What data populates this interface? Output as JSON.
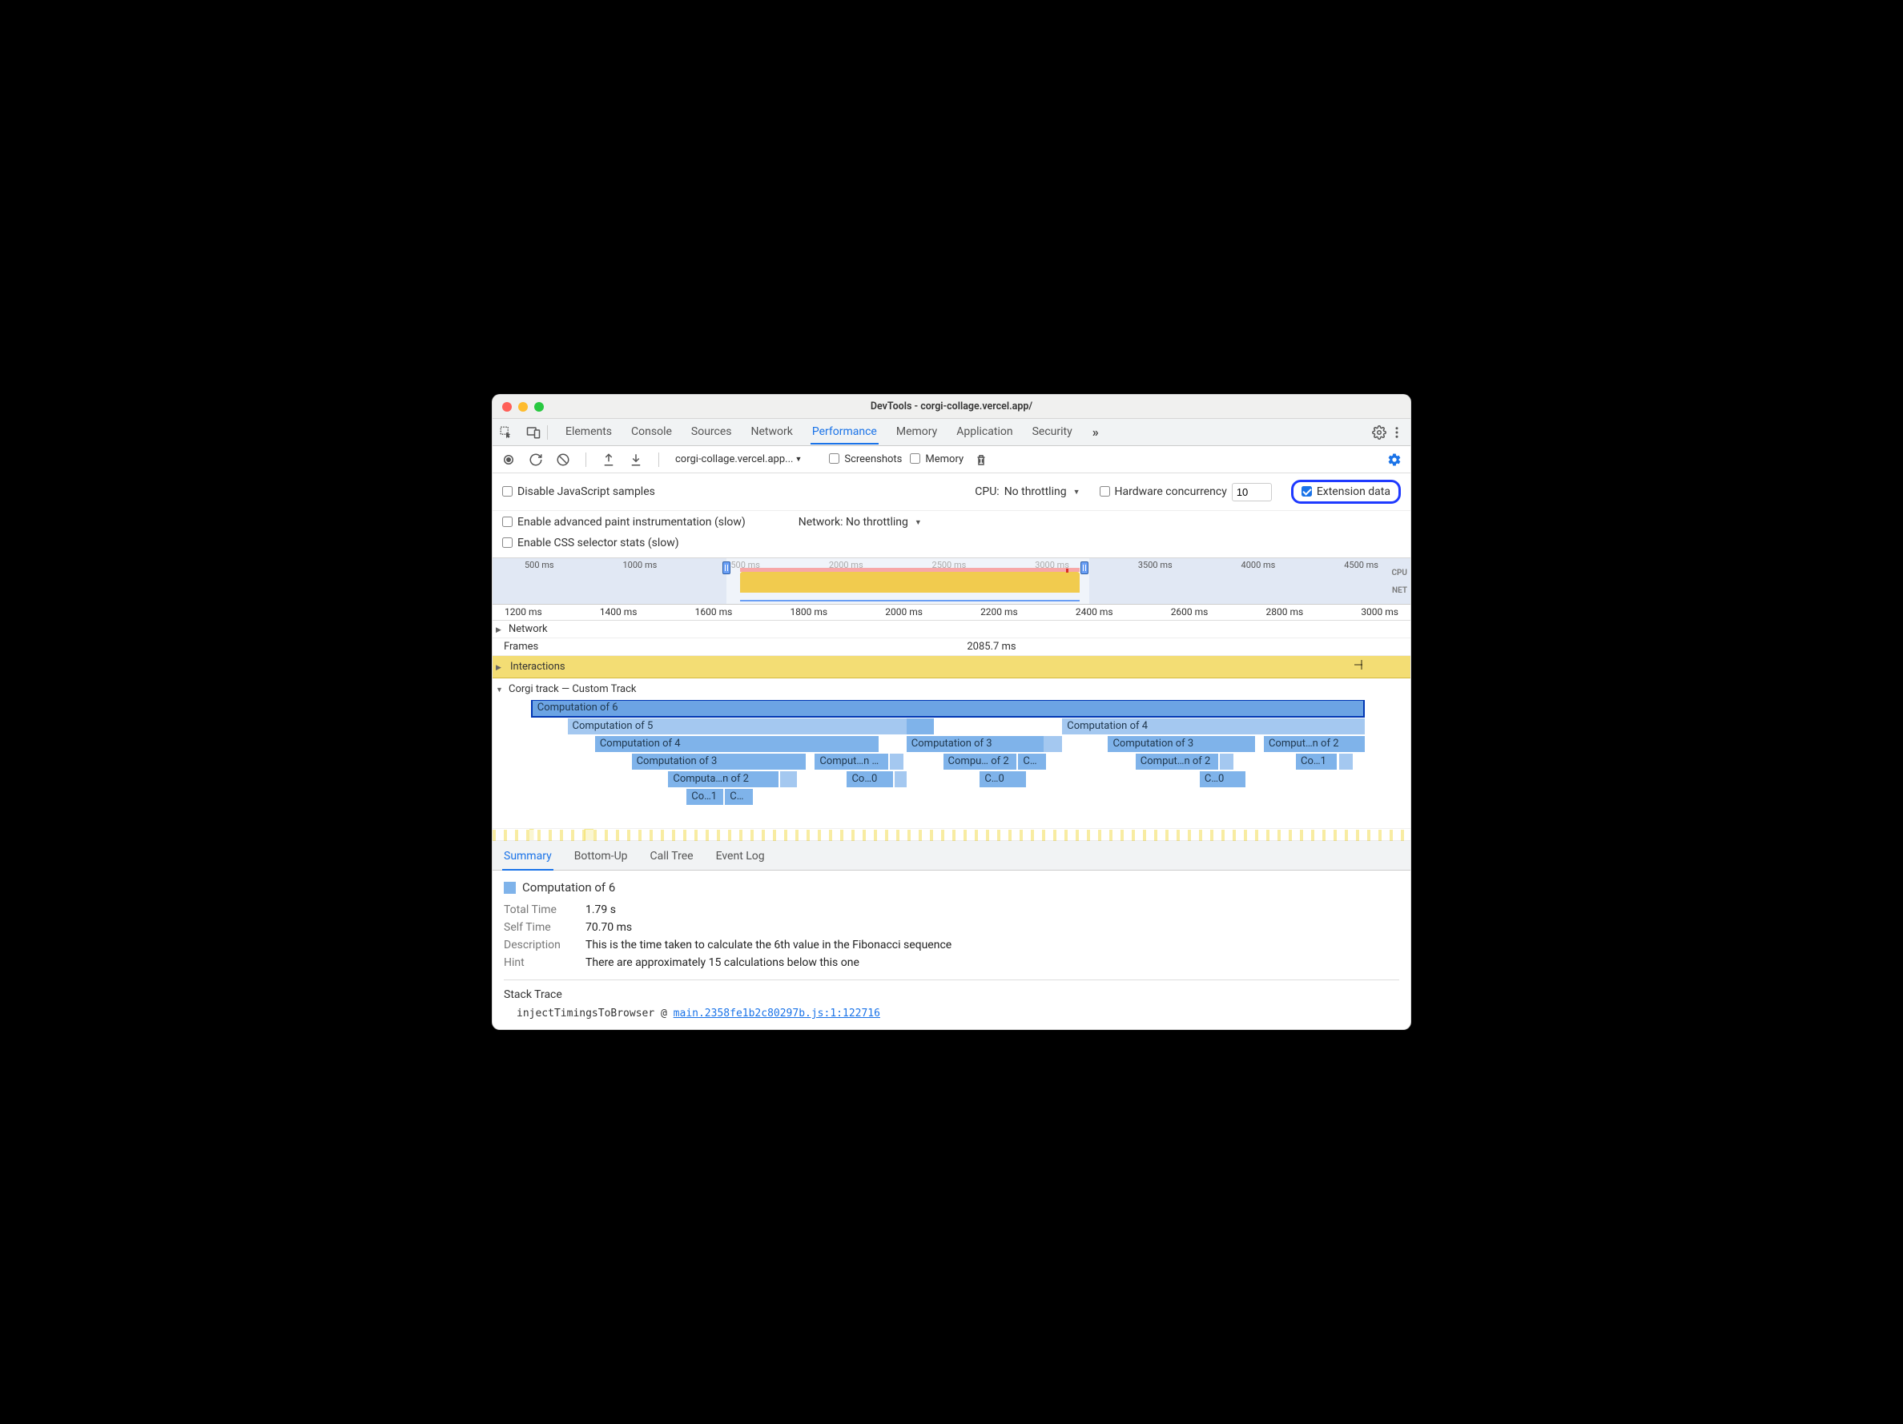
{
  "window": {
    "title": "DevTools - corgi-collage.vercel.app/"
  },
  "topTabs": {
    "items": [
      "Elements",
      "Console",
      "Sources",
      "Network",
      "Performance",
      "Memory",
      "Application",
      "Security"
    ],
    "active": "Performance"
  },
  "toolbar": {
    "url": "corgi-collage.vercel.app...",
    "screenshots_label": "Screenshots",
    "screenshots_checked": false,
    "memory_label": "Memory",
    "memory_checked": false
  },
  "perfSettings": {
    "disable_js_label": "Disable JavaScript samples",
    "disable_js_checked": false,
    "cpu_label": "CPU:",
    "cpu_value": "No throttling",
    "hw_concurrency_label": "Hardware concurrency",
    "hw_concurrency_checked": false,
    "hw_concurrency_value": "10",
    "ext_data_label": "Extension data",
    "ext_data_checked": true,
    "adv_paint_label": "Enable advanced paint instrumentation (slow)",
    "adv_paint_checked": false,
    "network_label": "Network:",
    "network_value": "No throttling",
    "css_stats_label": "Enable CSS selector stats (slow)",
    "css_stats_checked": false
  },
  "overview": {
    "ticks": [
      "500 ms",
      "1000 ms",
      "1500 ms",
      "2000 ms",
      "2500 ms",
      "3000 ms",
      "3500 ms",
      "4000 ms",
      "4500 ms"
    ],
    "right_labels": [
      "CPU",
      "NET"
    ]
  },
  "ruler": {
    "ticks": [
      "1200 ms",
      "1400 ms",
      "1600 ms",
      "1800 ms",
      "2000 ms",
      "2200 ms",
      "2400 ms",
      "2600 ms",
      "2800 ms",
      "3000 ms"
    ]
  },
  "tracks": {
    "network_label": "Network",
    "frames_label": "Frames",
    "frames_value": "2085.7 ms",
    "interactions_label": "Interactions",
    "custom_track_label": "Corgi track — Custom Track"
  },
  "flame": {
    "rows": [
      [
        {
          "label": "Computation of 6",
          "l": 4,
          "w": 91,
          "cls": "sel"
        }
      ],
      [
        {
          "label": "Computation of 5",
          "l": 8,
          "w": 37,
          "cls": "lt"
        },
        {
          "label": "",
          "l": 45,
          "w": 3,
          "cls": "md"
        },
        {
          "label": "Computation of 4",
          "l": 62,
          "w": 33,
          "cls": "lt"
        }
      ],
      [
        {
          "label": "Computation of 4",
          "l": 11,
          "w": 31,
          "cls": "md"
        },
        {
          "label": "Computation of 3",
          "l": 45,
          "w": 15,
          "cls": "md"
        },
        {
          "label": "",
          "l": 60,
          "w": 2,
          "cls": "lt"
        },
        {
          "label": "Computation of 3",
          "l": 67,
          "w": 16,
          "cls": "md"
        },
        {
          "label": "Comput…n of 2",
          "l": 84,
          "w": 11,
          "cls": "md"
        }
      ],
      [
        {
          "label": "Computation of 3",
          "l": 15,
          "w": 19,
          "cls": "md"
        },
        {
          "label": "Comput…n of 2",
          "l": 35,
          "w": 8,
          "cls": "md"
        },
        {
          "label": "",
          "l": 43.2,
          "w": 1.5,
          "cls": "lt"
        },
        {
          "label": "Compu… of 2",
          "l": 49,
          "w": 8,
          "cls": "md"
        },
        {
          "label": "C…",
          "l": 57.2,
          "w": 3,
          "cls": "md"
        },
        {
          "label": "Comput…n of 2",
          "l": 70,
          "w": 9,
          "cls": "md"
        },
        {
          "label": "",
          "l": 79.2,
          "w": 1.5,
          "cls": "lt"
        },
        {
          "label": "Co…1",
          "l": 87.5,
          "w": 4.5,
          "cls": "md"
        },
        {
          "label": "",
          "l": 92.2,
          "w": 1.5,
          "cls": "lt"
        }
      ],
      [
        {
          "label": "Computa…n of 2",
          "l": 19,
          "w": 12,
          "cls": "md"
        },
        {
          "label": "",
          "l": 31.2,
          "w": 1.8,
          "cls": "lt"
        },
        {
          "label": "Co…0",
          "l": 38.5,
          "w": 5,
          "cls": "md"
        },
        {
          "label": "",
          "l": 43.7,
          "w": 1.3,
          "cls": "lt"
        },
        {
          "label": "C…0",
          "l": 53,
          "w": 5,
          "cls": "md"
        },
        {
          "label": "C…0",
          "l": 77,
          "w": 5,
          "cls": "md"
        }
      ],
      [
        {
          "label": "Co…1",
          "l": 21,
          "w": 4,
          "cls": "md"
        },
        {
          "label": "C…",
          "l": 25.2,
          "w": 3,
          "cls": "md"
        }
      ]
    ]
  },
  "detailTabs": {
    "items": [
      "Summary",
      "Bottom-Up",
      "Call Tree",
      "Event Log"
    ],
    "active": "Summary"
  },
  "summary": {
    "title": "Computation of 6",
    "total_time_k": "Total Time",
    "total_time_v": "1.79 s",
    "self_time_k": "Self Time",
    "self_time_v": "70.70 ms",
    "desc_k": "Description",
    "desc_v": "This is the time taken to calculate the 6th value in the Fibonacci sequence",
    "hint_k": "Hint",
    "hint_v": "There are approximately 15 calculations below this one",
    "stack_title": "Stack Trace",
    "stack_fn": "injectTimingsToBrowser",
    "stack_sep": " @ ",
    "stack_link": "main.2358fe1b2c80297b.js:1:122716"
  }
}
